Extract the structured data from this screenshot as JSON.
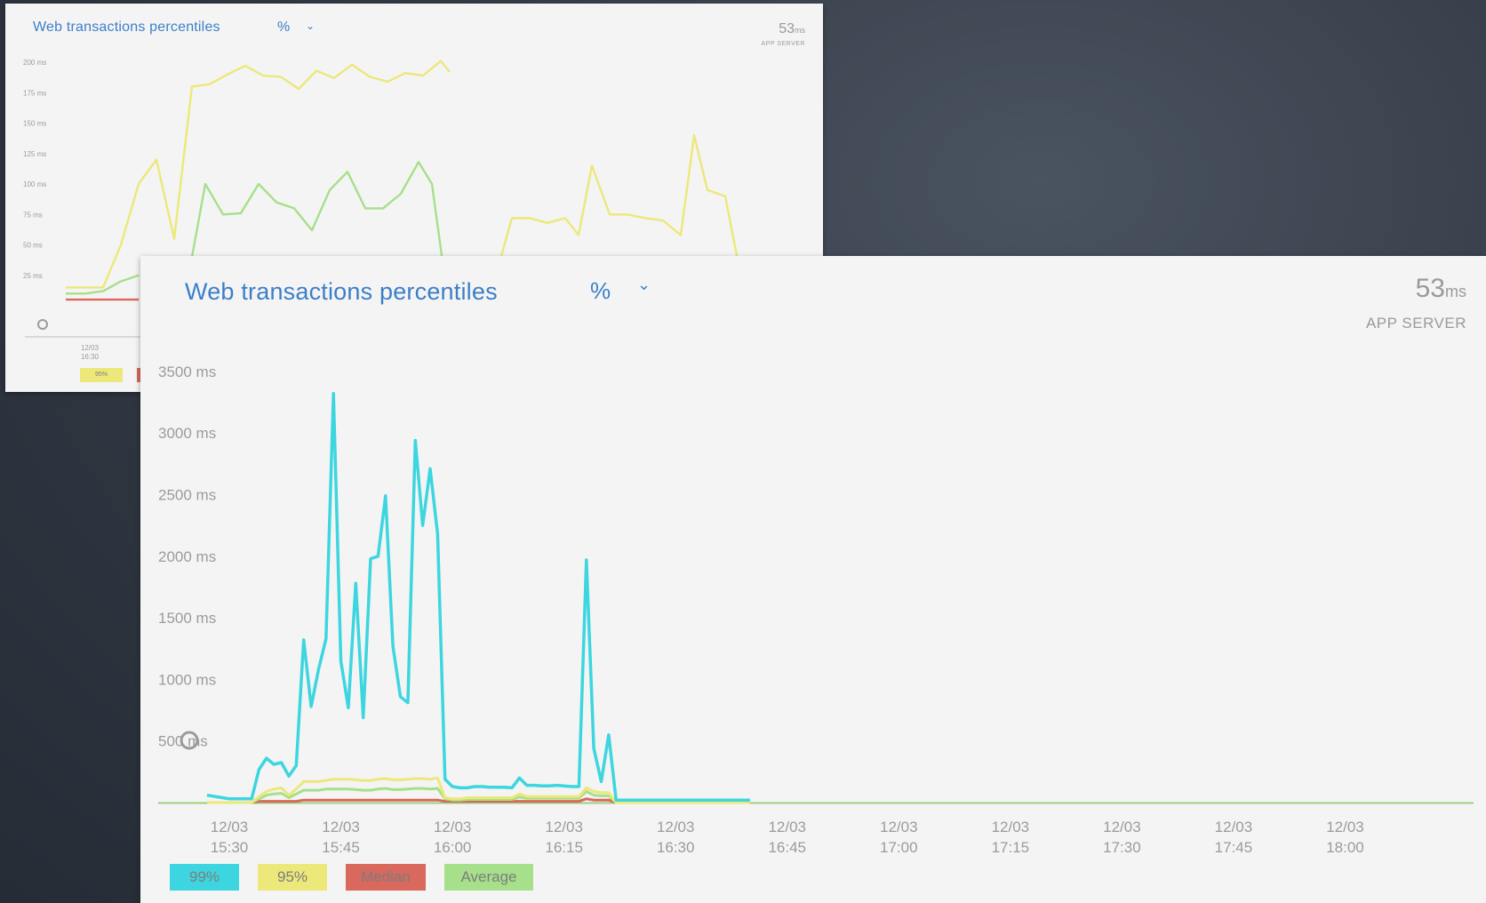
{
  "front_panel": {
    "title": "Web transactions percentiles",
    "unit_selector": "%",
    "metric_value": "53",
    "metric_unit": "ms",
    "metric_label": "APP SERVER"
  },
  "back_panel": {
    "title": "Web transactions percentiles",
    "unit_selector": "%",
    "metric_value": "53",
    "metric_unit": "ms",
    "metric_label": "APP SERVER",
    "y_ticks": [
      "200 ms",
      "175 ms",
      "150 ms",
      "125 ms",
      "100 ms",
      "75 ms",
      "50 ms",
      "25 ms"
    ],
    "x_tick": [
      "12/03",
      "16:30"
    ],
    "legend": [
      {
        "label": "95%",
        "color": "#ece87a"
      },
      {
        "label": "Median",
        "color": "#d9685d"
      }
    ]
  },
  "colors": {
    "p99": "#3dd6e0",
    "p95": "#ece87a",
    "median": "#d9685d",
    "average": "#a6e08a",
    "baseline": "#9bd07d",
    "title": "#3c7fc8"
  },
  "chart_data": [
    {
      "type": "line",
      "title": "Web transactions percentiles",
      "ylabel": "",
      "ylim": [
        0,
        3500
      ],
      "y_ticks": [
        "3500 ms",
        "3000 ms",
        "2500 ms",
        "2000 ms",
        "1500 ms",
        "1000 ms",
        "500 ms"
      ],
      "x_ticks": [
        [
          "12/03",
          "15:30"
        ],
        [
          "12/03",
          "15:45"
        ],
        [
          "12/03",
          "16:00"
        ],
        [
          "12/03",
          "16:15"
        ],
        [
          "12/03",
          "16:30"
        ],
        [
          "12/03",
          "16:45"
        ],
        [
          "12/03",
          "17:00"
        ],
        [
          "12/03",
          "17:15"
        ],
        [
          "12/03",
          "17:30"
        ],
        [
          "12/03",
          "17:45"
        ],
        [
          "12/03",
          "18:00"
        ]
      ],
      "x": [
        -3,
        0,
        1,
        2,
        3,
        4,
        5,
        6,
        7,
        8,
        9,
        10,
        11,
        12,
        13,
        14,
        15,
        16,
        17,
        18,
        19,
        20,
        21,
        22,
        23,
        24,
        25,
        26,
        27,
        28,
        29,
        30,
        31,
        32,
        33,
        34,
        35,
        36,
        37,
        38,
        39,
        40,
        41,
        42,
        43,
        44,
        45,
        46,
        47,
        48,
        49,
        50,
        51,
        52,
        53,
        54,
        55,
        56,
        57,
        58,
        59,
        60,
        61,
        62,
        63,
        64,
        65,
        66,
        67,
        68,
        69,
        70
      ],
      "x_unit": "minutes after 15:30",
      "series": [
        {
          "name": "99%",
          "values": [
            60,
            30,
            30,
            30,
            30,
            270,
            360,
            310,
            325,
            215,
            300,
            1320,
            780,
            1080,
            1330,
            3320,
            1150,
            770,
            1780,
            690,
            1980,
            2000,
            2490,
            1270,
            860,
            810,
            2940,
            2250,
            2710,
            2180,
            190,
            130,
            120,
            120,
            130,
            130,
            125,
            125,
            125,
            120,
            200,
            140,
            140,
            135,
            135,
            140,
            135,
            130,
            130,
            1970,
            440,
            170,
            550,
            20,
            20,
            20,
            20,
            20,
            20,
            20,
            20,
            20,
            20,
            20,
            20,
            20,
            20,
            20,
            20,
            20,
            20,
            20
          ]
        },
        {
          "name": "95%",
          "values": [
            0,
            0,
            0,
            0,
            0,
            50,
            90,
            110,
            120,
            60,
            110,
            170,
            170,
            170,
            180,
            190,
            190,
            190,
            185,
            180,
            180,
            190,
            195,
            185,
            185,
            190,
            195,
            195,
            190,
            200,
            40,
            30,
            30,
            40,
            40,
            40,
            40,
            40,
            40,
            40,
            70,
            50,
            50,
            50,
            50,
            50,
            50,
            50,
            50,
            120,
            90,
            80,
            80,
            0,
            0,
            0,
            0,
            0,
            0,
            0,
            0,
            0,
            0,
            0,
            0,
            0,
            0,
            0,
            0,
            0,
            0,
            0
          ]
        },
        {
          "name": "Median",
          "values": [
            0,
            0,
            0,
            0,
            0,
            10,
            10,
            10,
            10,
            10,
            10,
            20,
            20,
            20,
            20,
            20,
            20,
            20,
            20,
            20,
            20,
            20,
            20,
            20,
            20,
            20,
            20,
            20,
            20,
            20,
            10,
            10,
            10,
            10,
            10,
            10,
            10,
            10,
            10,
            10,
            10,
            10,
            10,
            10,
            10,
            10,
            10,
            10,
            10,
            30,
            20,
            20,
            20,
            0,
            0,
            0,
            0,
            0,
            0,
            0,
            0,
            0,
            0,
            0,
            0,
            0,
            0,
            0,
            0,
            0,
            0,
            0
          ]
        },
        {
          "name": "Average",
          "values": [
            0,
            0,
            0,
            0,
            0,
            30,
            60,
            70,
            75,
            40,
            70,
            100,
            100,
            100,
            110,
            110,
            110,
            110,
            105,
            100,
            100,
            110,
            115,
            105,
            105,
            110,
            115,
            115,
            110,
            115,
            30,
            20,
            20,
            25,
            25,
            25,
            25,
            25,
            25,
            25,
            45,
            35,
            35,
            35,
            35,
            35,
            35,
            35,
            35,
            90,
            60,
            55,
            55,
            0,
            0,
            0,
            0,
            0,
            0,
            0,
            0,
            0,
            0,
            0,
            0,
            0,
            0,
            0,
            0,
            0,
            0,
            0
          ]
        }
      ],
      "legend": [
        {
          "label": "99%",
          "color": "#3dd6e0"
        },
        {
          "label": "95%",
          "color": "#ece87a"
        },
        {
          "label": "Median",
          "color": "#d9685d"
        },
        {
          "label": "Average",
          "color": "#a6e08a"
        }
      ],
      "grid": false
    },
    {
      "type": "line",
      "title": "Web transactions percentiles",
      "ylim": [
        0,
        200
      ],
      "series": [
        {
          "name": "95%",
          "values": [
            15,
            15,
            15,
            50,
            100,
            120,
            55,
            180,
            182,
            190,
            197,
            189,
            188,
            178,
            193,
            187,
            198,
            188,
            184,
            191,
            189,
            201,
            192
          ]
        },
        {
          "name": "Average",
          "values": [
            10,
            10,
            12,
            20,
            25
          ]
        },
        {
          "name": "Median",
          "values": [
            5,
            5,
            5,
            5,
            5
          ]
        }
      ]
    }
  ]
}
